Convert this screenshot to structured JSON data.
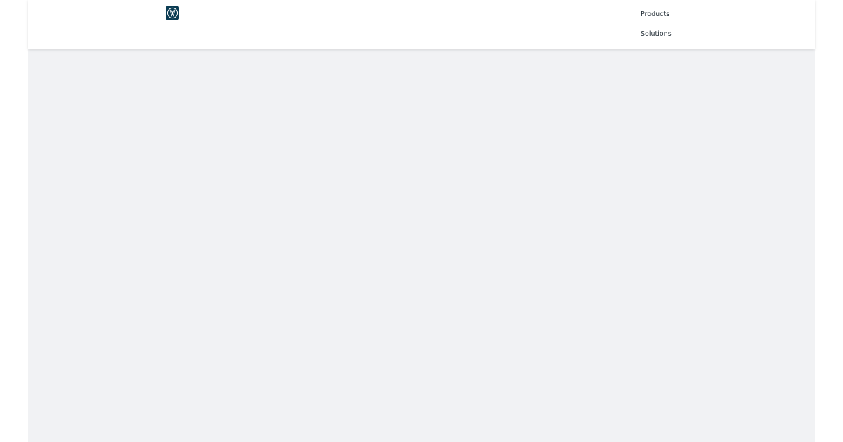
{
  "header": {
    "logo_icon": "vw-logo-icon",
    "brand_color": "#0b3c53",
    "nav": {
      "items": [
        {
          "label": "Products"
        },
        {
          "label": "Solutions"
        }
      ]
    }
  },
  "content": {
    "background_color": "#f1f2f4"
  }
}
